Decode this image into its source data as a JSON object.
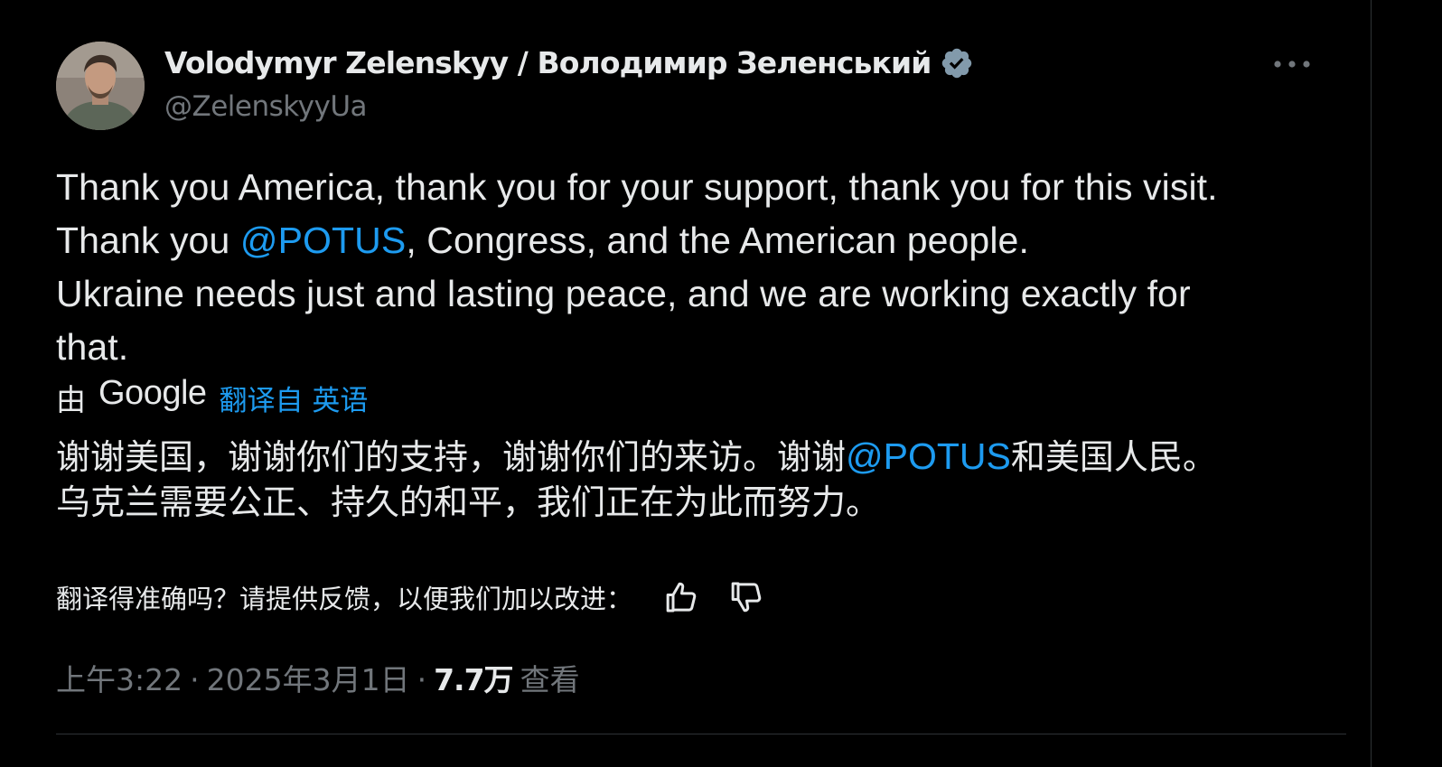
{
  "author": {
    "display_name": "Volodymyr Zelenskyy / Володимир Зеленський",
    "handle": "@ZelenskyyUa",
    "verified_icon": "verified-badge-icon",
    "avatar_icon": "profile-avatar"
  },
  "post": {
    "text_lines": [
      {
        "before": "Thank you America, thank you for your support, thank you for this visit.",
        "mention": "",
        "after": ""
      },
      {
        "before": "Thank you ",
        "mention": "@POTUS",
        "after": ", Congress, and the American people."
      },
      {
        "before": "Ukraine needs just and lasting peace, and we are working exactly for",
        "mention": "",
        "after": ""
      },
      {
        "before": "that.",
        "mention": "",
        "after": ""
      }
    ]
  },
  "translation": {
    "prefix": "由",
    "provider": "Google",
    "link_label": "翻译自 英语",
    "line1_before": "谢谢美国，谢谢你们的支持，谢谢你们的来访。谢谢",
    "line1_mention": "@POTUS",
    "line1_after": "和美国人民。",
    "line2": "乌克兰需要公正、持久的和平，我们正在为此而努力。",
    "feedback_prompt": "翻译得准确吗？请提供反馈，以便我们加以改进：",
    "thumbs_up_icon": "thumbs-up-icon",
    "thumbs_down_icon": "thumbs-down-icon"
  },
  "meta": {
    "time": "上午3:22",
    "separator": "·",
    "date": "2025年3月1日",
    "views_count": "7.7万",
    "views_label": "查看"
  },
  "menu_icon": "more-horizontal-icon",
  "colors": {
    "background": "#000000",
    "text_primary": "#e7e9ea",
    "text_secondary": "#71767b",
    "link": "#1d9bf0",
    "border": "#2f3336"
  }
}
